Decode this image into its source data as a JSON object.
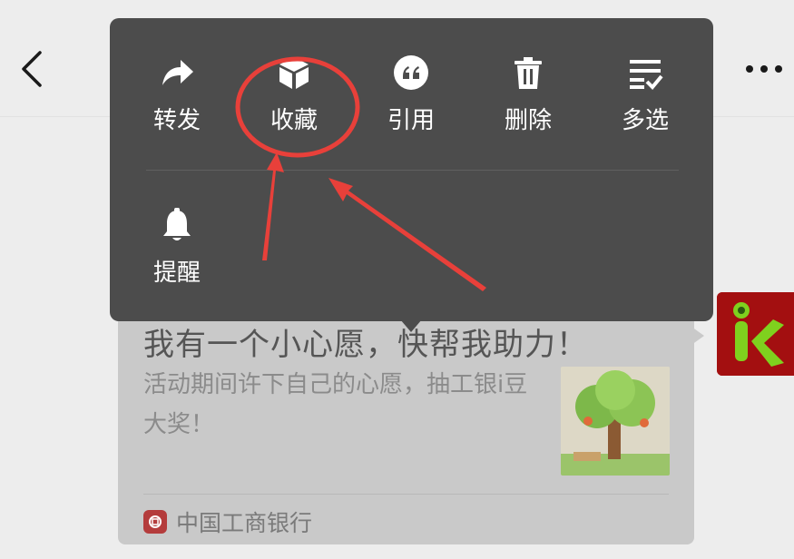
{
  "menu": {
    "items": [
      {
        "label": "转发",
        "icon": "forward-icon"
      },
      {
        "label": "收藏",
        "icon": "favorite-cube-icon"
      },
      {
        "label": "引用",
        "icon": "quote-icon"
      },
      {
        "label": "删除",
        "icon": "trash-icon"
      },
      {
        "label": "多选",
        "icon": "multi-select-icon"
      },
      {
        "label": "提醒",
        "icon": "bell-icon"
      }
    ]
  },
  "message": {
    "title": "我有一个小心愿，快帮我助力！",
    "description": "活动期间许下自己的心愿，抽工银i豆大奖！",
    "source": "中国工商银行"
  },
  "colors": {
    "menu_bg": "#4c4c4c",
    "annotation": "#e8403a",
    "avatar_bg": "#a30f10",
    "avatar_letter": "#7fd11e"
  }
}
